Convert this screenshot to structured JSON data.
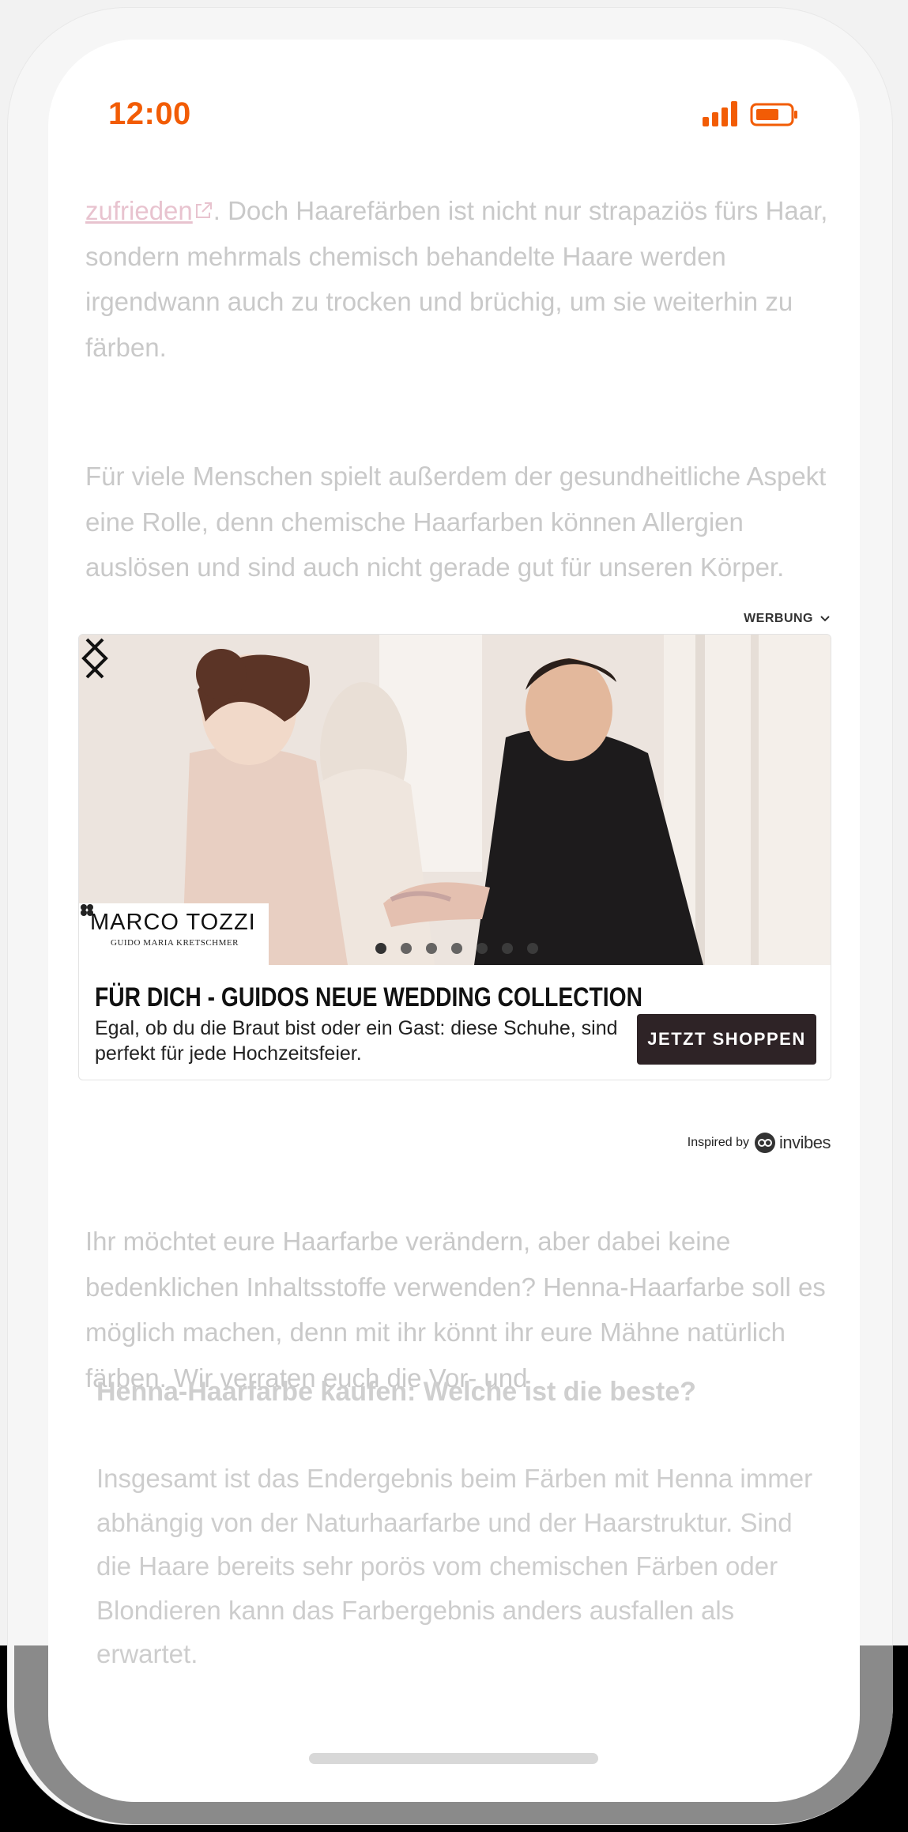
{
  "status_bar": {
    "time": "12:00"
  },
  "article": {
    "para1_link": "zufrieden",
    "para1_rest": ". Doch Haarefärben ist nicht nur strapaziös fürs Haar, sondern mehrmals chemisch behandelte Haare werden irgendwann auch zu trocken und brüchig, um sie weiterhin zu färben.",
    "para2": "Für viele Menschen spielt außerdem der gesundheitliche Aspekt eine Rolle, denn chemische Haarfarben können Allergien auslösen und sind auch nicht gerade gut für unseren Körper.",
    "para3": "Ihr möchtet eure Haarfarbe verändern, aber dabei keine bedenklichen Inhaltsstoffe verwenden? Henna-Haarfarbe soll es möglich machen, denn mit ihr könnt ihr eure Mähne natürlich färben. Wir verraten euch die Vor- und",
    "heading": "Henna-Haarfarbe kaufen: Welche ist die beste?",
    "para4": "Insgesamt ist das Endergebnis beim Färben mit Henna immer abhängig von der Naturhaarfarbe und der Haarstruktur. Sind die Haare bereits sehr porös vom chemischen Färben oder Blondieren kann das Farbergebnis anders ausfallen als erwartet."
  },
  "ad": {
    "label": "WERBUNG",
    "brand_name": "MARCO TOZZI",
    "brand_sub": "GUIDO MARIA KRETSCHMER",
    "title": "FÜR DICH - GUIDOS NEUE WEDDING COLLECTION",
    "description": "Egal, ob du die Braut bist oder ein Gast: diese Schuhe, sind perfekt für jede Hochzeitsfeier.",
    "cta": "JETZT SHOPPEN",
    "slide_count": 7,
    "active_slide": 1,
    "inspired_by": "Inspired by",
    "invibes": "invibes"
  },
  "colors": {
    "accent": "#f25c05",
    "cta_bg": "#2e2326",
    "faded_text": "#c9c9c9"
  }
}
